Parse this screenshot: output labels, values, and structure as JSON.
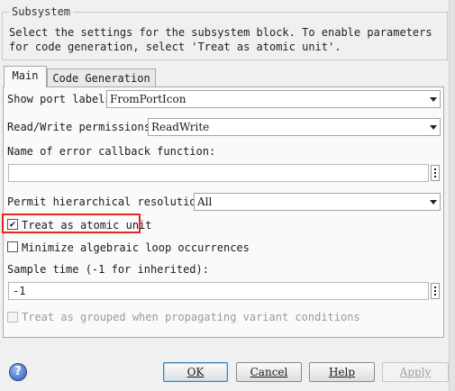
{
  "group": {
    "title": "Subsystem",
    "description": "Select the settings for the subsystem block. To enable parameters for code generation, select 'Treat as atomic unit'."
  },
  "tabs": [
    {
      "label": "Main",
      "active": true
    },
    {
      "label": "Code Generation",
      "active": false
    }
  ],
  "main": {
    "port_labels": {
      "label": "Show port labels",
      "value": "FromPortIcon"
    },
    "rw_permissions": {
      "label": "Read/Write permissions:",
      "value": "ReadWrite"
    },
    "error_callback": {
      "label": "Name of error callback function:",
      "value": ""
    },
    "hier_resolution": {
      "label": "Permit hierarchical resolution:",
      "value": "All"
    },
    "atomic_unit": {
      "label": "Treat as atomic unit",
      "checked": true
    },
    "minimize_loop": {
      "label": "Minimize algebraic loop occurrences",
      "checked": false
    },
    "sample_time": {
      "label": "Sample time (-1 for inherited):",
      "value": "-1"
    },
    "grouped_variant": {
      "label": "Treat as grouped when propagating variant conditions",
      "checked": false,
      "enabled": false
    }
  },
  "buttons": {
    "ok": "OK",
    "cancel": "Cancel",
    "help": "Help",
    "apply": "Apply"
  },
  "colors": {
    "highlight": "#e8251f",
    "ok_border": "#3c7fb1"
  }
}
